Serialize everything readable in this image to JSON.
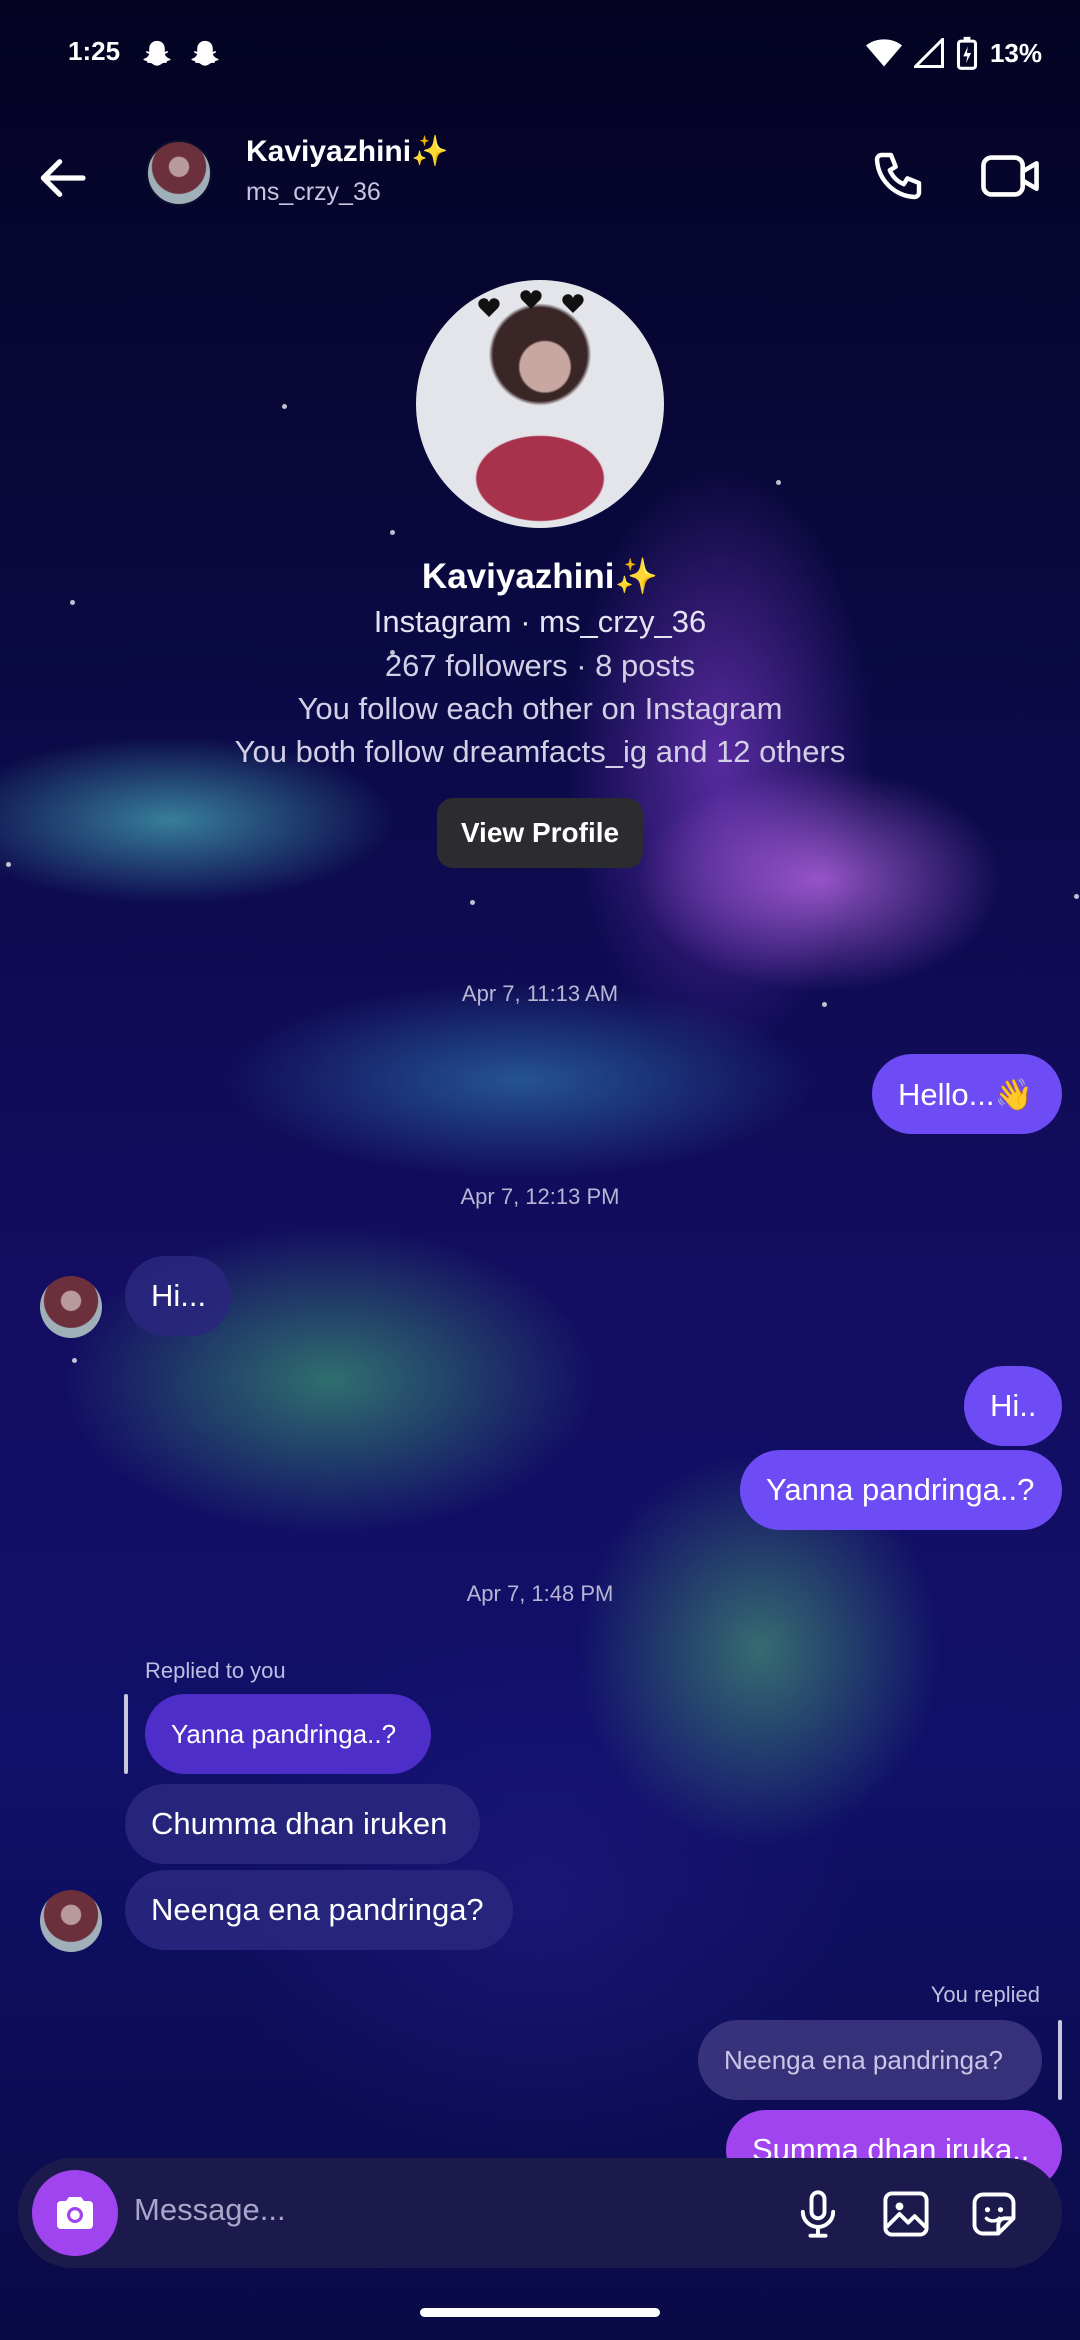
{
  "status_bar": {
    "time": "1:25",
    "battery": "13%"
  },
  "header": {
    "name": "Kaviyazhini✨",
    "username": "ms_crzy_36"
  },
  "profile": {
    "name": "Kaviyazhini✨",
    "source": "Instagram · ms_crzy_36",
    "stats": "267 followers · 8 posts",
    "follow_status": "You follow each other on Instagram",
    "mutuals": "You both follow dreamfacts_ig and 12 others",
    "view_profile_label": "View Profile"
  },
  "messages": {
    "stamp1": "Apr 7, 11:13 AM",
    "m1": "Hello...👋",
    "stamp2": "Apr 7, 12:13 PM",
    "m2": "Hi...",
    "m3": "Hi..",
    "m4": "Yanna pandringa..?",
    "stamp3": "Apr 7, 1:48 PM",
    "replied_label": "Replied to you",
    "reply_quote": "Yanna pandringa..?",
    "m5": "Chumma dhan iruken",
    "m6": "Neenga ena pandringa?",
    "you_replied_label": "You replied",
    "your_quote": "Neenga ena pandringa?",
    "m7": "Summa dhan iruka.."
  },
  "composer": {
    "placeholder": "Message..."
  },
  "icons": [
    "snapchat-icon",
    "wifi-icon",
    "signal-icon",
    "battery-icon",
    "back-arrow-icon",
    "phone-icon",
    "video-icon",
    "camera-icon",
    "microphone-icon",
    "gallery-icon",
    "sticker-icon"
  ]
}
